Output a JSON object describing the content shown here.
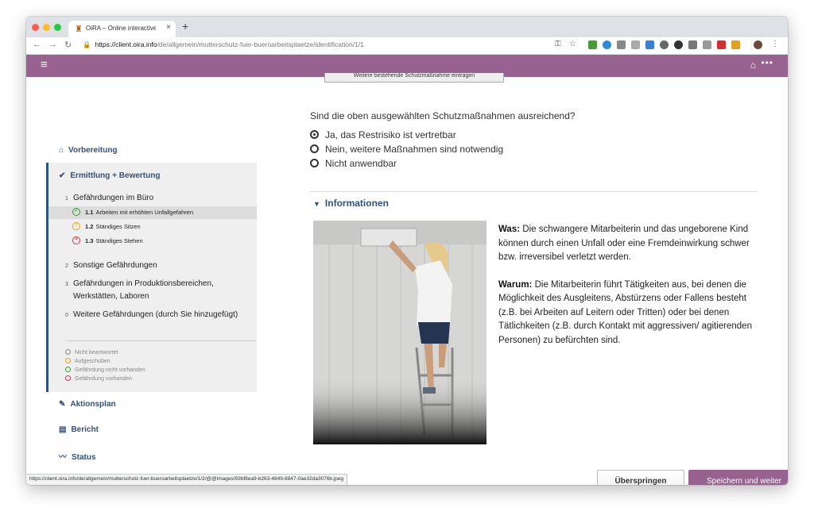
{
  "browser": {
    "tab_title": "OiRA – Online interactive Risk A",
    "tab_close": "×",
    "new_tab": "+",
    "url_host": "https://client.oira.info",
    "url_path": "/de/allgemein/mutterschutz-fuer-bueroarbeitsplaetze/identification/1/1",
    "status_url": "https://client.oira.info/de/allgemein/mutterschutz-fuer-bueroarbeitsplaetze/1/2/@@images/93bf8ea9-b263-4849-8847-0ae32da3076b.jpeg"
  },
  "sidebar": {
    "vorbereitung": "Vorbereitung",
    "ermittlung": "Ermittlung + Bewertung",
    "modules": [
      {
        "num": "1",
        "label": "Gefährdungen im Büro"
      },
      {
        "num": "2",
        "label": "Sonstige Gefährdungen"
      },
      {
        "num": "3",
        "label": "Gefährdungen in Produktionsbereichen,",
        "label2": "Werkstätten, Laboren"
      },
      {
        "num": "0",
        "label": "Weitere Gefährdungen (durch Sie hinzugefügt)"
      }
    ],
    "risks": [
      {
        "num": "1.1",
        "label": "Arbeiten mit erhöhten Unfallgefahren",
        "status": "ok"
      },
      {
        "num": "1.2",
        "label": "Ständiges Sitzen",
        "status": "postponed"
      },
      {
        "num": "1.3",
        "label": "Ständiges Stehen",
        "status": "risk"
      }
    ],
    "legend": [
      "Nicht beantwortet",
      "Aufgeschoben",
      "Gefährdung nicht vorhanden",
      "Gefährdung vorhanden"
    ],
    "aktionsplan": "Aktionsplan",
    "bericht": "Bericht",
    "status": "Status"
  },
  "main": {
    "top_button": "Weitere bestehende Schutzmaßnahme eintragen",
    "question": "Sind die oben ausgewählten Schutzmaßnahmen ausreichend?",
    "options": [
      {
        "label": "Ja, das Restrisiko ist vertretbar",
        "checked": true
      },
      {
        "label": "Nein, weitere Maßnahmen sind notwendig",
        "checked": false
      },
      {
        "label": "Nicht anwendbar",
        "checked": false
      }
    ],
    "info_title": "Informationen",
    "was_label": "Was:",
    "was_text": "Die schwangere Mitarbeiterin und das ungeborene Kind können durch einen Unfall oder eine Fremdeinwirkung schwer bzw. irreversibel verletzt werden.",
    "warum_label": "Warum:",
    "warum_text": "Die Mitarbeiterin führt Tätigkeiten aus, bei denen die Möglichkeit des Ausgleitens, Abstürzens oder Fallens besteht (z.B. bei Arbeiten auf Leitern oder Tritten) oder bei denen Tätlichkeiten (z.B. durch Kontakt mit aggressiven/ agitierenden Personen) zu befürchten sind.",
    "back_label": "<",
    "skip_label": "Überspringen",
    "save_label": "Speichern und weiter"
  },
  "colors": {
    "brand": "#97628f",
    "nav_blue": "#30527a",
    "ok": "#3a9a3a",
    "postponed": "#e8a317",
    "risk": "#d9304a",
    "unanswered": "#888888"
  }
}
